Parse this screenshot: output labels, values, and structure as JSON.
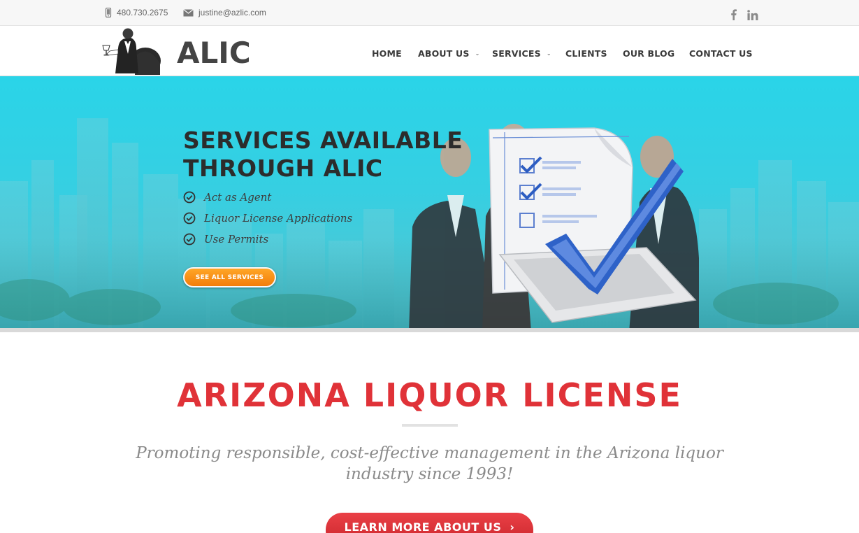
{
  "topbar": {
    "phone": "480.730.2675",
    "email": "justine@azlic.com",
    "social": [
      "facebook-icon",
      "linkedin-icon"
    ]
  },
  "header": {
    "logo_text": "ALIC",
    "nav": [
      {
        "label": "HOME"
      },
      {
        "label": "ABOUT US",
        "has_dropdown": true
      },
      {
        "label": "SERVICES",
        "has_dropdown": true
      },
      {
        "label": "CLIENTS"
      },
      {
        "label": "OUR BLOG"
      },
      {
        "label": "CONTACT US"
      }
    ]
  },
  "hero": {
    "title_line1": "SERVICES AVAILABLE",
    "title_line2": "THROUGH ALIC",
    "features": [
      "Act as Agent",
      "Liquor License Applications",
      "Use Permits"
    ],
    "button_label": "SEE ALL SERVICES"
  },
  "content": {
    "title": "ARIZONA LIQUOR LICENSE",
    "tagline": "Promoting responsible, cost-effective management in the Arizona liquor industry since 1993!",
    "button_label": "LEARN MORE ABOUT US"
  },
  "colors": {
    "accent_red": "#e03238",
    "hero_cyan": "#2ad4e8",
    "button_orange": "#f27d0a"
  }
}
